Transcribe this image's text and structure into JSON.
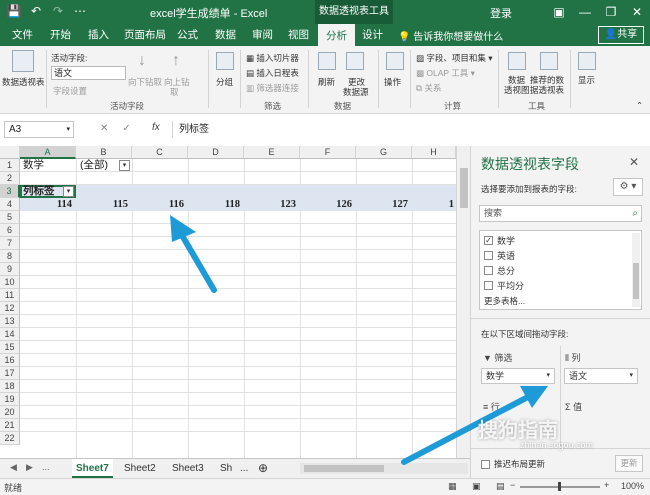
{
  "window": {
    "doc_title": "excel学生成绩单 - Excel",
    "tools_tag": "数据透视表工具",
    "login": "登录",
    "min": "—",
    "restore": "❐",
    "close": "✕"
  },
  "qat": {
    "save_icon": "💾",
    "undo_icon": "↶",
    "redo_icon": "↷",
    "more_icon": "⋯"
  },
  "tabs": {
    "file": "文件",
    "home": "开始",
    "insert": "插入",
    "layout": "页面布局",
    "formula": "公式",
    "data": "数据",
    "review": "审阅",
    "view": "视图",
    "analyze": "分析",
    "design": "设计",
    "tellme": "告诉我你想要做什么",
    "share": "共享"
  },
  "ribbon": {
    "pivot_table": "数据透视表",
    "active_field_label": "活动字段:",
    "active_field_value": "语文",
    "field_settings": "字段设置",
    "drill_down": "向下钻取",
    "drill_up": "向上钻",
    "drill_up2": "取",
    "group_active_field": "活动字段",
    "group_btn": "分组",
    "insert_slicer": "插入切片器",
    "insert_timeline": "插入日程表",
    "filter_conn": "筛选器连接",
    "group_filter": "筛选",
    "refresh": "刷新",
    "change_source": "更改",
    "change_source2": "数据源",
    "group_data": "数据",
    "actions": "操作",
    "fields_items": "字段、项目和集",
    "olap": "OLAP 工具",
    "relations": "关系",
    "group_calc": "计算",
    "pivot_chart": "数据",
    "pivot_chart2": "透视图",
    "recommended": "推荐的数",
    "recommended2": "据透视表",
    "group_tools": "工具",
    "show": "显示"
  },
  "formula_bar": {
    "name_box": "A3",
    "cancel": "✕",
    "enter": "✓",
    "fx": "fx",
    "content": "列标签"
  },
  "grid": {
    "columns": [
      "A",
      "B",
      "C",
      "D",
      "E",
      "F",
      "G",
      "H"
    ],
    "rows": [
      "1",
      "2",
      "3",
      "4",
      "5",
      "6",
      "7",
      "8",
      "9",
      "10",
      "11",
      "12",
      "13",
      "14",
      "15",
      "16",
      "17",
      "18",
      "19",
      "20",
      "21",
      "22"
    ],
    "a1": "数学",
    "b1": "(全部)",
    "a3": "列标签",
    "row4": [
      "114",
      "115",
      "116",
      "118",
      "123",
      "126",
      "127",
      "1"
    ]
  },
  "sheets": {
    "nav_prev": "◀",
    "nav_next": "▶",
    "nav_more": "...",
    "tabs": [
      "Sheet7",
      "Sheet2",
      "Sheet3",
      "Sh"
    ],
    "more": "...",
    "add": "⊕"
  },
  "status": {
    "ready": "就绪",
    "zoom": "100%"
  },
  "pane": {
    "title": "数据透视表字段",
    "close": "✕",
    "hint": "选择要添加到报表的字段:",
    "gear": "⚙ ▾",
    "search_placeholder": "搜索",
    "fields": [
      {
        "name": "数学",
        "checked": "✓"
      },
      {
        "name": "英语",
        "checked": ""
      },
      {
        "name": "总分",
        "checked": ""
      },
      {
        "name": "平均分",
        "checked": ""
      }
    ],
    "more_tables": "更多表格...",
    "area_hint": "在以下区域间拖动字段:",
    "filter_label": "筛选",
    "columns_label": "列",
    "rows_label": "行",
    "values_label": "值",
    "filter_field": "数学",
    "columns_field": "语文",
    "defer": "推迟布局更新",
    "update": "更新"
  },
  "watermark": {
    "text": "搜狗指南",
    "url": "zhinan.sogou.com"
  }
}
